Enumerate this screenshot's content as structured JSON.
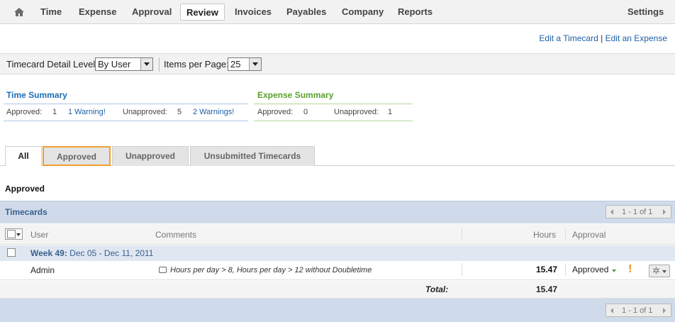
{
  "nav": {
    "items": [
      {
        "label": "Time"
      },
      {
        "label": "Expense"
      },
      {
        "label": "Approval"
      },
      {
        "label": "Review"
      },
      {
        "label": "Invoices"
      },
      {
        "label": "Payables"
      },
      {
        "label": "Company"
      },
      {
        "label": "Reports"
      },
      {
        "label": "Settings"
      }
    ],
    "active": "Review",
    "home_icon": "home-icon"
  },
  "links": {
    "edit_timecard": "Edit a Timecard",
    "separator": "|",
    "edit_expense": "Edit an Expense"
  },
  "options": {
    "detail_label": "Timecard Detail Level:",
    "detail_value": "By User",
    "items_label": "Items per Page:",
    "items_value": "25"
  },
  "time_summary": {
    "title": "Time Summary",
    "approved_label": "Approved:",
    "approved_value": "1",
    "warning_link": "1 Warning!",
    "unapproved_label": "Unapproved:",
    "unapproved_value": "5",
    "warnings_link": "2 Warnings!",
    "color": "#1d6fb8"
  },
  "expense_summary": {
    "title": "Expense Summary",
    "approved_label": "Approved:",
    "approved_value": "0",
    "unapproved_label": "Unapproved:",
    "unapproved_value": "1",
    "color": "#5aa02c"
  },
  "tabs": [
    {
      "label": "All"
    },
    {
      "label": "Approved"
    },
    {
      "label": "Unapproved"
    },
    {
      "label": "Unsubmitted Timecards"
    }
  ],
  "section_title": "Approved",
  "timecards": {
    "title": "Timecards",
    "pager_text": "1 - 1 of 1",
    "columns": {
      "user": "User",
      "comments": "Comments",
      "hours": "Hours",
      "approval": "Approval"
    },
    "week": {
      "label": "Week 49:",
      "range": "Dec 05 - Dec 11, 2011"
    },
    "rows": [
      {
        "user": "Admin",
        "comment": "Hours per day > 8, Hours per day > 12 without Doubletime",
        "hours": "15.47",
        "approval": "Approved"
      }
    ],
    "total_label": "Total:",
    "total_value": "15.47"
  }
}
